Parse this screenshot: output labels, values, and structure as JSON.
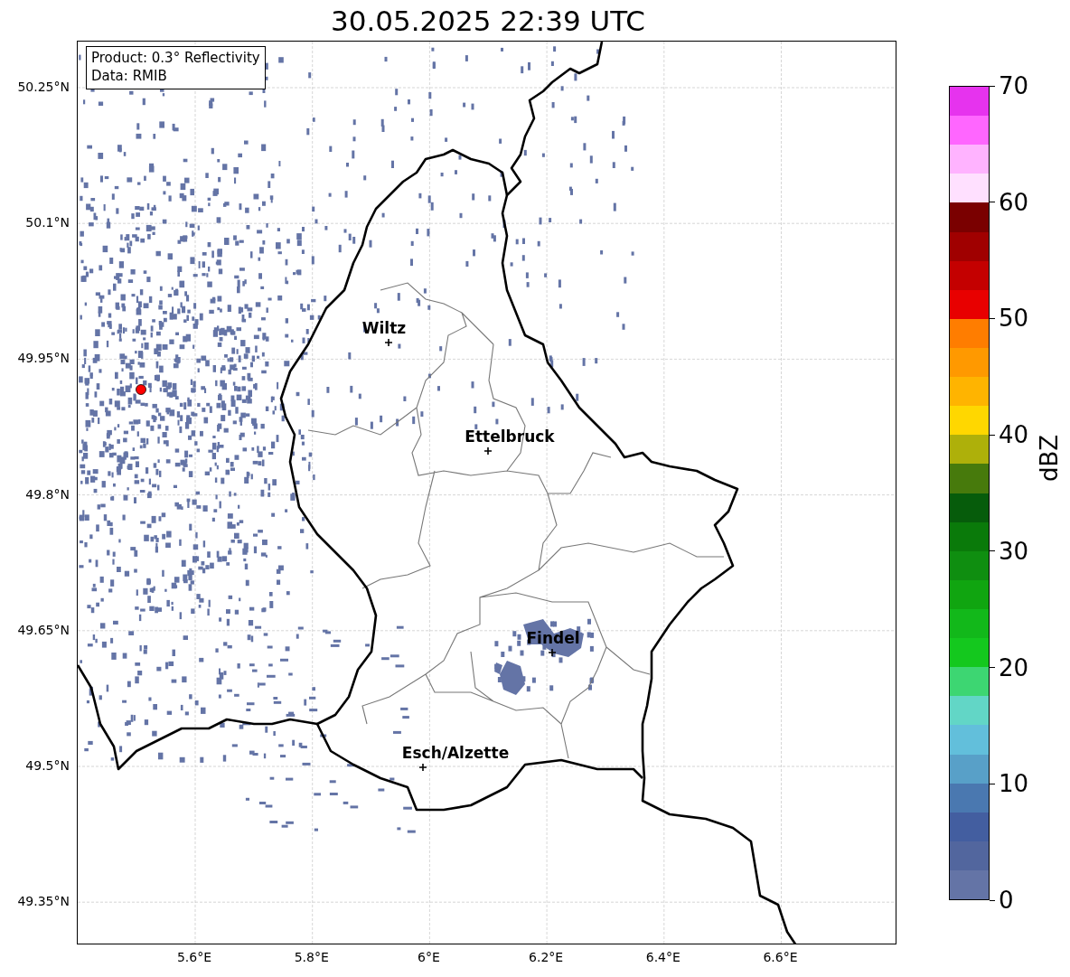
{
  "title": "30.05.2025 22:39 UTC",
  "info_box": {
    "product": "Product: 0.3° Reflectivity",
    "data": "Data: RMIB"
  },
  "map": {
    "lat_ticks": [
      "50.25°N",
      "50.1°N",
      "49.95°N",
      "49.8°N",
      "49.65°N",
      "49.5°N",
      "49.35°N"
    ],
    "lon_ticks": [
      "5.6°E",
      "5.8°E",
      "6°E",
      "6.2°E",
      "6.4°E",
      "6.6°E"
    ],
    "cities": [
      {
        "name": "Wiltz"
      },
      {
        "name": "Ettelbruck"
      },
      {
        "name": "Findel"
      },
      {
        "name": "Esch/Alzette"
      }
    ]
  },
  "colorbar": {
    "label": "dBZ",
    "ticks": [
      "70",
      "60",
      "50",
      "40",
      "30",
      "20",
      "10",
      "0"
    ],
    "bands": [
      {
        "color": "#e633ee"
      },
      {
        "color": "#ff66ff"
      },
      {
        "color": "#ffb3ff"
      },
      {
        "color": "#ffe0ff"
      },
      {
        "color": "#7a0000"
      },
      {
        "color": "#a00000"
      },
      {
        "color": "#c40000"
      },
      {
        "color": "#e80000"
      },
      {
        "color": "#ff7d00"
      },
      {
        "color": "#ff9900"
      },
      {
        "color": "#ffb400"
      },
      {
        "color": "#ffd700"
      },
      {
        "color": "#aeb00a"
      },
      {
        "color": "#477a0c"
      },
      {
        "color": "#065c0b"
      },
      {
        "color": "#0a7a0a"
      },
      {
        "color": "#0f8e10"
      },
      {
        "color": "#10a510"
      },
      {
        "color": "#12b81a"
      },
      {
        "color": "#14c81e"
      },
      {
        "color": "#3dd672"
      },
      {
        "color": "#62d6c6"
      },
      {
        "color": "#62bfdb"
      },
      {
        "color": "#58a0c8"
      },
      {
        "color": "#4a78b0"
      },
      {
        "color": "#435ea0"
      },
      {
        "color": "#52669e"
      },
      {
        "color": "#6474a6"
      }
    ]
  }
}
